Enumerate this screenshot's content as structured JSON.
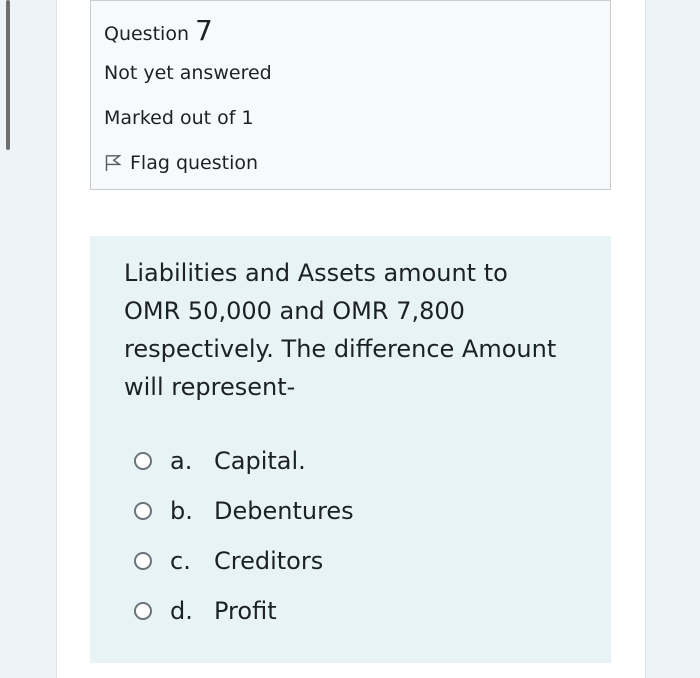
{
  "question_info": {
    "prefix": "Question",
    "number": "7",
    "state": "Not yet answered",
    "grade": "Marked out of 1",
    "flag_label": "Flag question"
  },
  "question": {
    "text": "Liabilities and Assets amount to OMR 50,000 and OMR 7,800 respectively. The difference Amount will represent-",
    "answers": [
      {
        "letter": "a.",
        "text": "Capital."
      },
      {
        "letter": "b.",
        "text": "Debentures"
      },
      {
        "letter": "c.",
        "text": "Creditors"
      },
      {
        "letter": "d.",
        "text": "Profit"
      }
    ]
  }
}
